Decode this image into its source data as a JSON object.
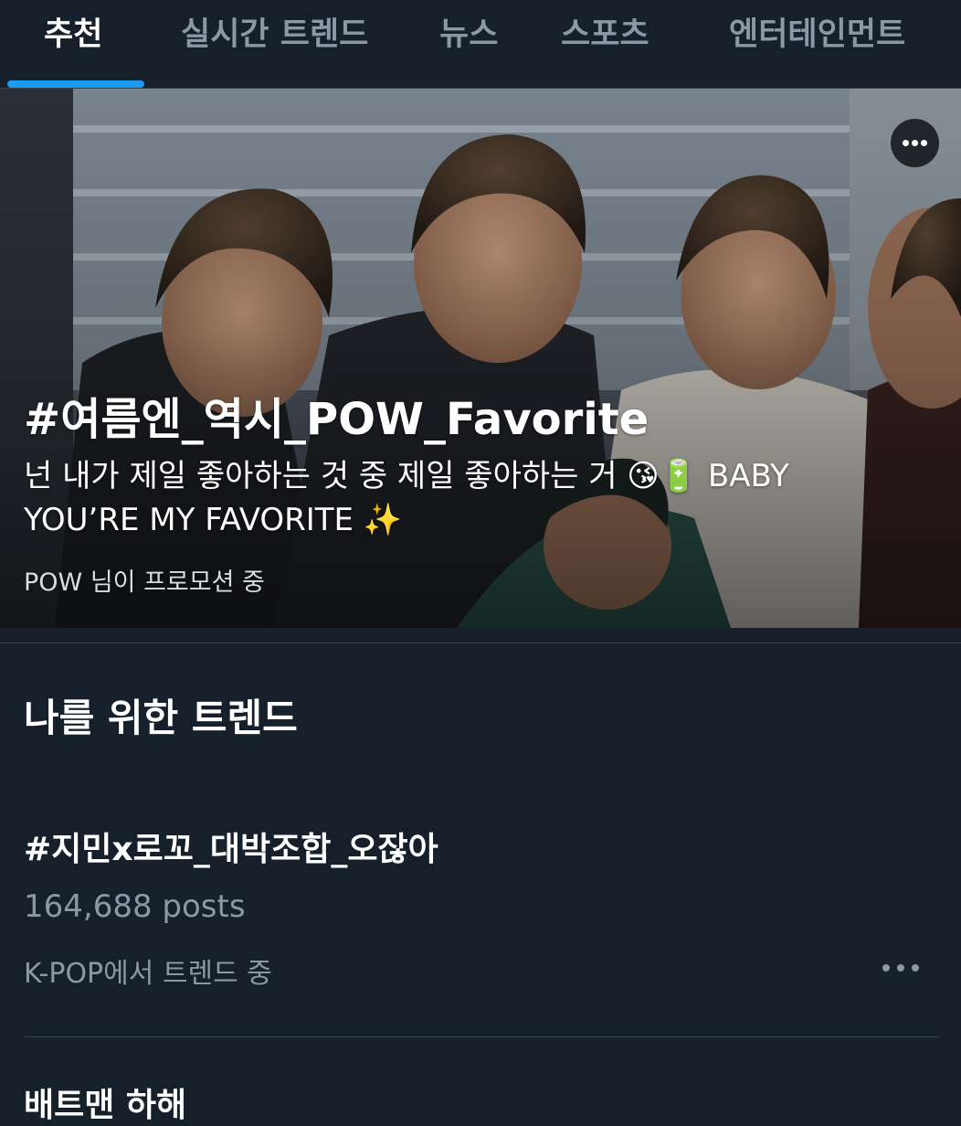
{
  "tabs": [
    {
      "label": "추천",
      "active": true
    },
    {
      "label": "실시간 트렌드",
      "active": false
    },
    {
      "label": "뉴스",
      "active": false
    },
    {
      "label": "스포츠",
      "active": false
    },
    {
      "label": "엔터테인먼트",
      "active": false
    }
  ],
  "promoted": {
    "title": "#여름엔_역시_POW_Favorite",
    "description": "넌 내가 제일 좋아하는 것 중 제일 좋아하는 거 😘🔋  BABY YOU’RE MY FAVORITE ✨",
    "promoted_by": "POW 님이 프로모션 중",
    "more_icon": "more-horizontal-icon"
  },
  "trends_section": {
    "title": "나를 위한 트렌드",
    "items": [
      {
        "name": "#지민x로꼬_대박조합_오잖아",
        "count": "164,688 posts",
        "context": "K-POP에서 트렌드 중",
        "more_icon": "more-horizontal-icon"
      }
    ],
    "next_item_partial": "배트맨 하해"
  },
  "colors": {
    "background": "#15202b",
    "accent": "#1d9bf0",
    "secondary_text": "#8b98a5",
    "divider": "#38444d"
  }
}
